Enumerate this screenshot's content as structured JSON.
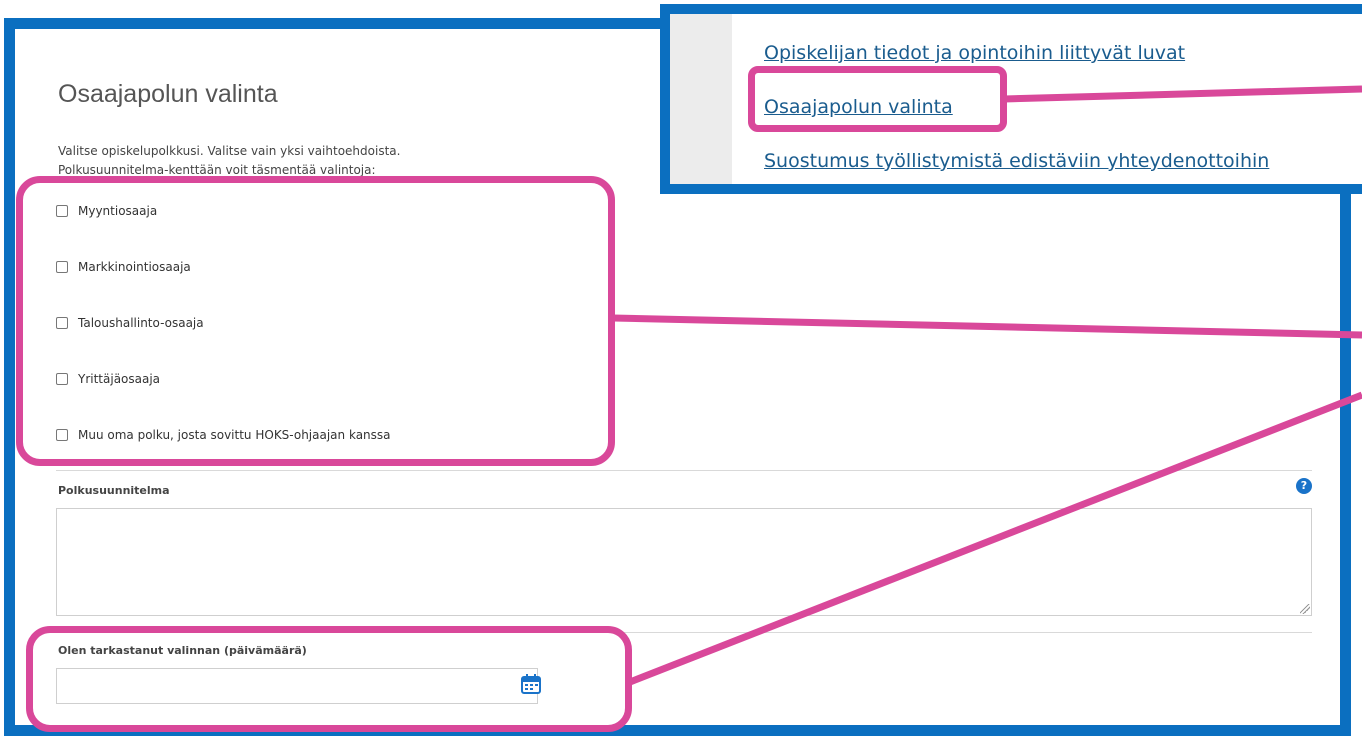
{
  "form": {
    "title": "Osaajapolun valinta",
    "instructions_line1": "Valitse opiskelupolkkusi. Valitse vain yksi vaihtoehdoista.",
    "instructions_line2": "Polkusuunnitelma-kenttään voit täsmentää valintoja:",
    "options": [
      {
        "label": "Myyntiosaaja",
        "checked": false
      },
      {
        "label": "Markkinointiosaaja",
        "checked": false
      },
      {
        "label": "Taloushallinto-osaaja",
        "checked": false
      },
      {
        "label": "Yrittäjäosaaja",
        "checked": false
      },
      {
        "label": "Muu oma polku, josta sovittu HOKS-ohjaajan kanssa",
        "checked": false
      }
    ],
    "plan_label": "Polkusuunnitelma",
    "plan_value": "",
    "help_glyph": "?",
    "date_label": "Olen tarkastanut valinnan (päivämäärä)",
    "date_value": ""
  },
  "nav": {
    "links": [
      "Opiskelijan tiedot ja opintoihin liittyvät luvat",
      "Osaajapolun valinta",
      "Suostumus työllistymistä edistäviin yhteydenottoihin"
    ]
  },
  "colors": {
    "frame_blue": "#0b6fc0",
    "highlight_pink": "#d9489a",
    "link_blue": "#1a5c8e",
    "help_blue": "#1a73c9"
  },
  "icons": {
    "help": "help-icon",
    "calendar": "calendar-icon",
    "checkbox": "checkbox-icon"
  }
}
